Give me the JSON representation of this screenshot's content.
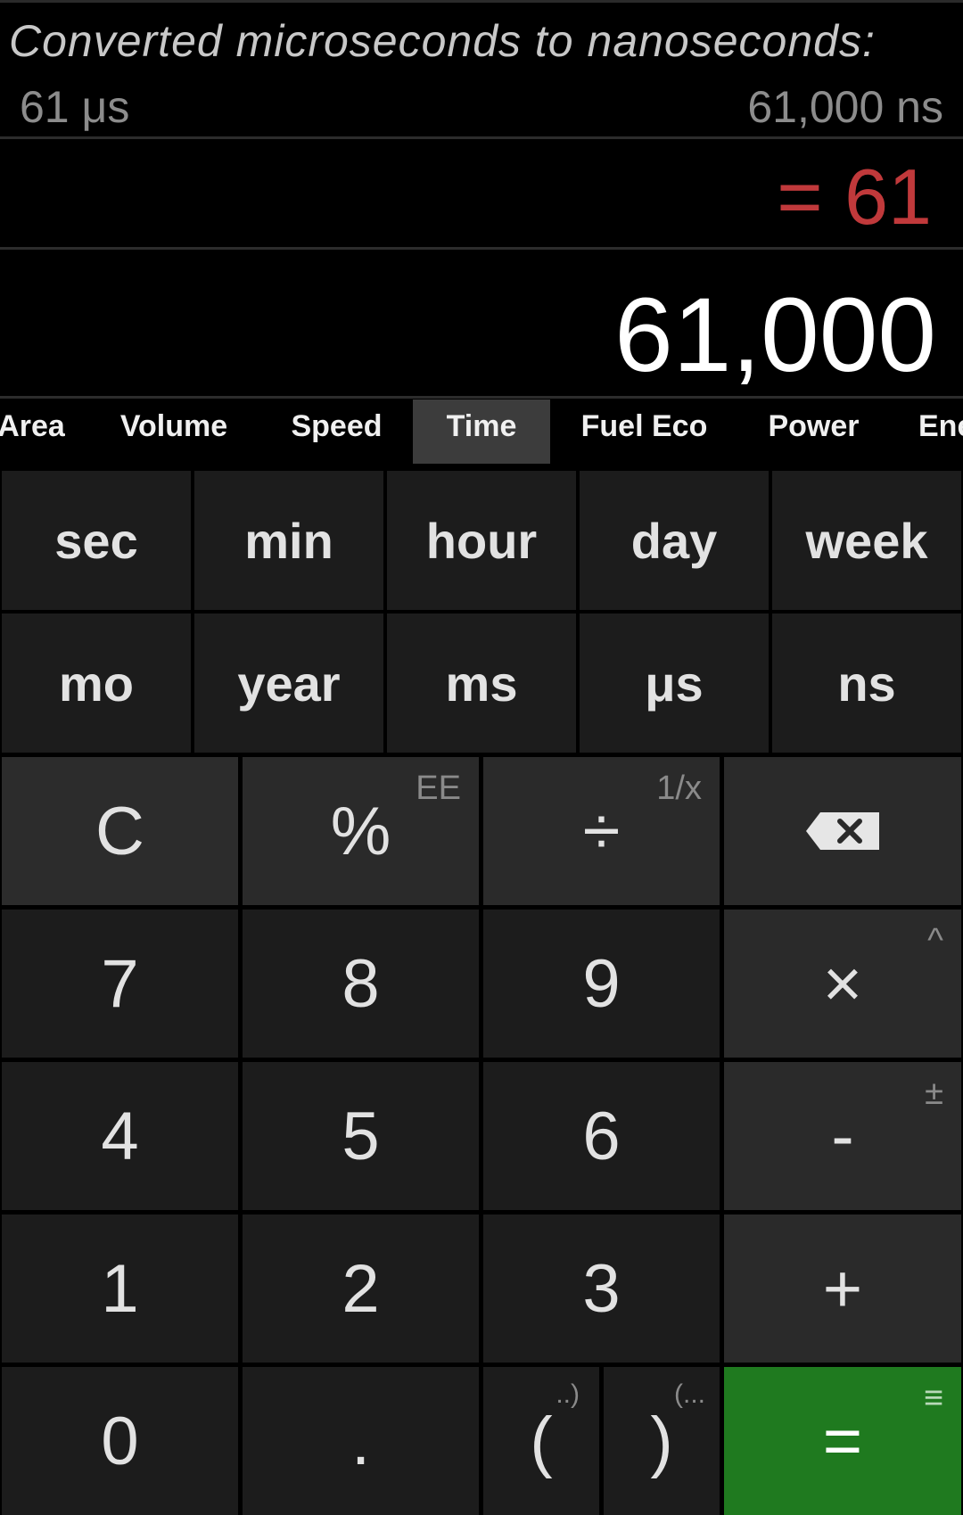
{
  "history": {
    "title": "Converted microseconds to nanoseconds:",
    "from": "61 μs",
    "to": "61,000 ns"
  },
  "expression": "= 61",
  "result": "61,000",
  "tabs": [
    "Area",
    "Volume",
    "Speed",
    "Time",
    "Fuel Eco",
    "Power",
    "Energy"
  ],
  "active_tab": "Time",
  "units_row1": [
    "sec",
    "min",
    "hour",
    "day",
    "week"
  ],
  "units_row2": [
    "mo",
    "year",
    "ms",
    "μs",
    "ns"
  ],
  "keys": {
    "clear": "C",
    "percent": "%",
    "percent_alt": "EE",
    "divide": "÷",
    "divide_alt": "1/x",
    "multiply": "×",
    "multiply_alt": "^",
    "minus": "-",
    "minus_alt": "±",
    "plus": "+",
    "equals": "=",
    "equals_alt": "≡",
    "dot": ".",
    "open_paren": "(",
    "open_paren_alt": "..)",
    "close_paren": ")",
    "close_paren_alt": "(...",
    "digits": [
      "0",
      "1",
      "2",
      "3",
      "4",
      "5",
      "6",
      "7",
      "8",
      "9"
    ]
  },
  "colors": {
    "expression": "#c0393b",
    "equals_key": "#1f7a1f",
    "active_tab": "#3c3c3c"
  }
}
